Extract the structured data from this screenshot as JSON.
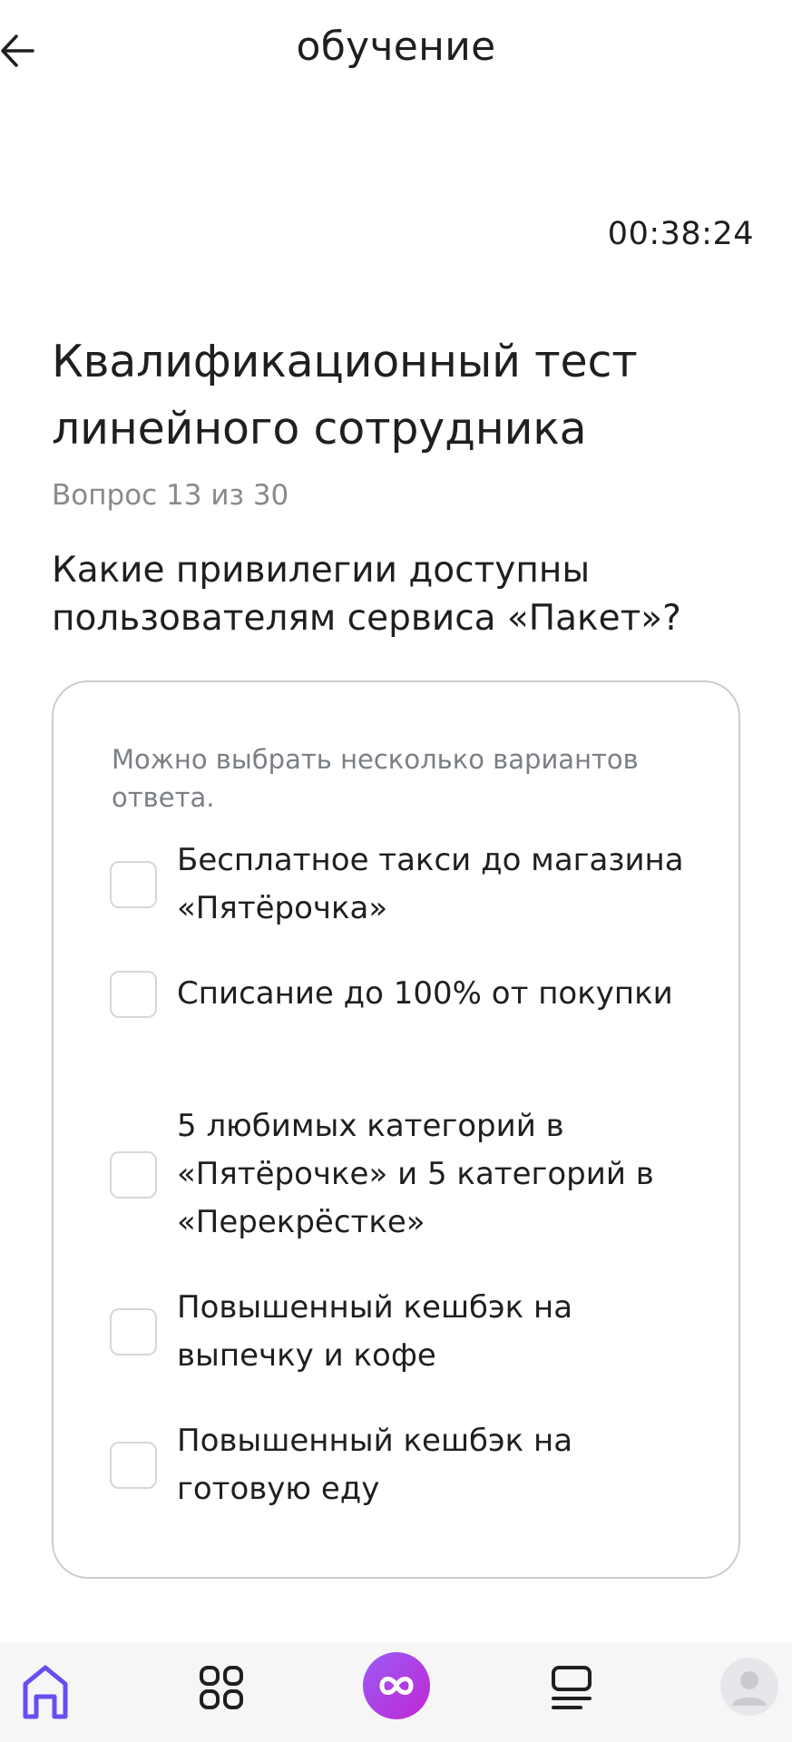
{
  "header": {
    "title": "обучение"
  },
  "timer": "00:38:24",
  "test": {
    "title": "Квалификационный тест линейного сотрудника",
    "counter": "Вопрос 13 из 30",
    "question": "Какие привилегии доступны пользователям сервиса «Пакет»?",
    "hint": "Можно выбрать несколько вариантов ответа.",
    "options": [
      "Бесплатное такси до магазина «Пятёрочка»",
      "Списание до 100% от покупки",
      "5 любимых категорий в «Пятёрочке» и 5 категорий в «Перекрёстке»",
      "Повышенный кешбэк на выпечку и кофе",
      "Повышенный кешбэк на готовую еду"
    ]
  },
  "nav": {
    "items": [
      "home-icon",
      "apps-grid-icon",
      "assistant-icon",
      "list-icon",
      "profile-icon"
    ],
    "active": "home-icon",
    "accent": "#6b4cf0"
  }
}
